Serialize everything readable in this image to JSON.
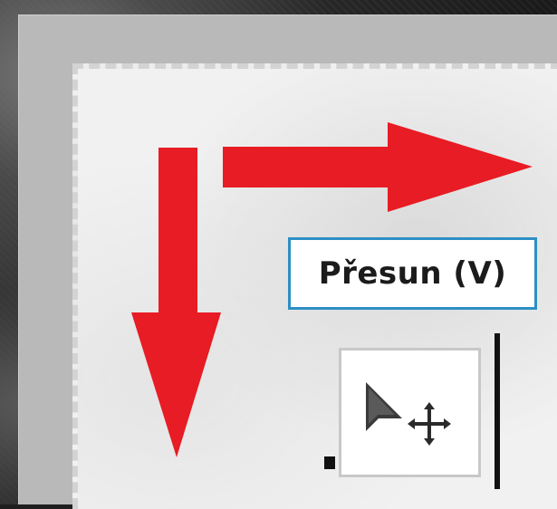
{
  "tooltip": {
    "label": "Přesun (V)",
    "shortcut": "V"
  },
  "tool": {
    "name": "move-tool",
    "icons": [
      "arrow-cursor-icon",
      "move-cross-icon"
    ]
  },
  "annotations": {
    "arrow_color": "#e81c24",
    "arrows": [
      "arrow-right",
      "arrow-down"
    ]
  },
  "colors": {
    "tooltip_border": "#2d8fc4",
    "frame": "#b9b9b9",
    "canvas": "#f1f1f1"
  }
}
